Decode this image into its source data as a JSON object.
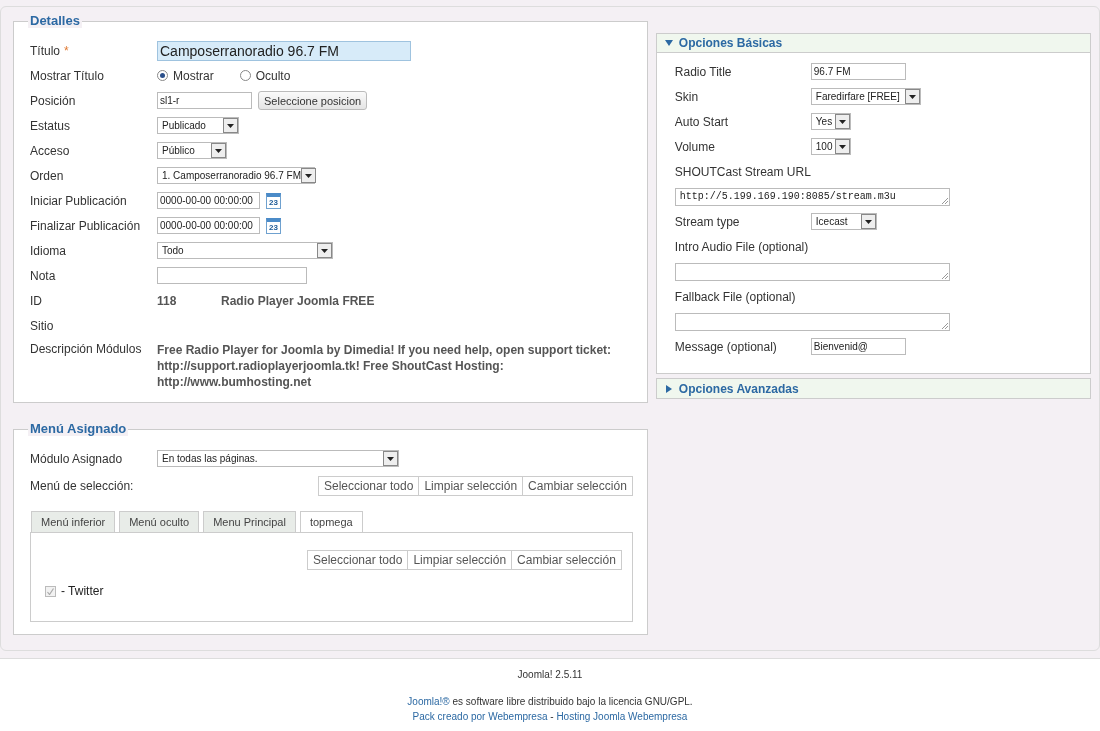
{
  "details": {
    "legend": "Detalles",
    "fields": [
      {
        "kind": "text",
        "label": "Título",
        "required_mark": "*",
        "value": "Camposerranoradio 96.7 FM",
        "highlight": true
      },
      {
        "kind": "radio",
        "label": "Mostrar Título",
        "options": [
          {
            "label": "Mostrar",
            "selected": true
          },
          {
            "label": "Oculto",
            "selected": false
          }
        ]
      },
      {
        "kind": "input_button",
        "label": "Posición",
        "value": "sl1-r",
        "button": "Seleccione posicion"
      },
      {
        "kind": "select",
        "label": "Estatus",
        "value": "Publicado"
      },
      {
        "kind": "select",
        "label": "Acceso",
        "value": "Público"
      },
      {
        "kind": "select",
        "label": "Orden",
        "value": "1. Camposerranoradio 96.7 FM"
      },
      {
        "kind": "date",
        "label": "Iniciar Publicación",
        "value": "0000-00-00 00:00:00",
        "icon_text": "23"
      },
      {
        "kind": "date",
        "label": "Finalizar Publicación",
        "value": "0000-00-00 00:00:00",
        "icon_text": "23"
      },
      {
        "kind": "select",
        "label": "Idioma",
        "value": "Todo"
      },
      {
        "kind": "empty_text",
        "label": "Nota"
      },
      {
        "kind": "static",
        "label": "ID",
        "value": "118",
        "extra": "Radio Player Joomla FREE"
      },
      {
        "kind": "label_only",
        "label": "Sitio"
      },
      {
        "kind": "desc",
        "label": "Descripción Módulos",
        "value": "Free Radio Player for Joomla by Dimedia! If you need help, open support ticket: http://support.radioplayerjoomla.tk! Free ShoutCast Hosting: http://www.bumhosting.net"
      }
    ]
  },
  "menu": {
    "legend": "Menú Asignado",
    "assigned_label": "Módulo Asignado",
    "assigned_value": "En todas las páginas.",
    "selection_label": "Menú de selección:",
    "buttons": [
      "Seleccionar todo",
      "Limpiar selección",
      "Cambiar selección"
    ],
    "tabs": [
      {
        "label": "Menú inferior",
        "selected": false
      },
      {
        "label": "Menú oculto",
        "selected": false
      },
      {
        "label": "Menu Principal",
        "selected": false
      },
      {
        "label": "topmega",
        "selected": true
      }
    ],
    "tab_buttons": [
      "Seleccionar todo",
      "Limpiar selección",
      "Cambiar selección"
    ],
    "items": [
      {
        "label": "- Twitter",
        "checked": true,
        "disabled": true
      }
    ]
  },
  "panels": [
    {
      "title": "Opciones Básicas",
      "expanded": true,
      "fields": [
        {
          "kind": "text",
          "label": "Radio Title",
          "value": "96.7 FM"
        },
        {
          "kind": "select",
          "label": "Skin",
          "value": "Faredirfare [FREE]"
        },
        {
          "kind": "select",
          "label": "Auto Start",
          "value": "Yes"
        },
        {
          "kind": "select",
          "label": "Volume",
          "value": "100"
        },
        {
          "kind": "textarea",
          "label": "SHOUTCast Stream URL",
          "value": "http://5.199.169.190:8085/stream.m3u"
        },
        {
          "kind": "select",
          "label": "Stream type",
          "value": "Icecast"
        },
        {
          "kind": "textarea",
          "label": "Intro Audio File (optional)"
        },
        {
          "kind": "textarea",
          "label": "Fallback File (optional)"
        },
        {
          "kind": "text",
          "label": "Message (optional)",
          "value": "Bienvenid@"
        }
      ]
    },
    {
      "title": "Opciones Avanzadas",
      "expanded": false
    }
  ],
  "footer": {
    "version": "Joomla! 2.5.11",
    "license": [
      {
        "kind": "link",
        "text": "Joomla!®"
      },
      {
        "kind": "plain",
        "text": " es software libre distribuido bajo la licencia GNU/GPL."
      }
    ],
    "credits": [
      {
        "kind": "link",
        "text": "Pack creado por Webempresa"
      },
      {
        "kind": "plain",
        "text": " - "
      },
      {
        "kind": "link",
        "text": "Hosting Joomla Webempresa"
      }
    ]
  }
}
